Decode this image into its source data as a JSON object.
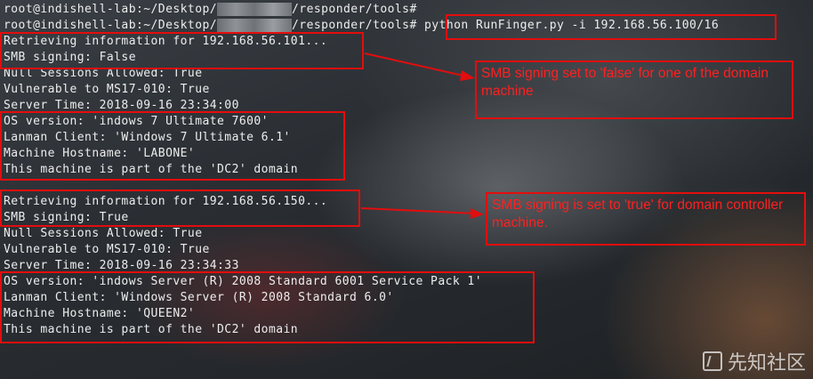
{
  "terminal": {
    "prompt_line_1": {
      "prefix": "root@indishell-lab:~/Desktop/",
      "suffix": "/responder/tools#"
    },
    "prompt_line_2": {
      "prefix": "root@indishell-lab:~/Desktop/",
      "suffix": "/responder/tools#",
      "command": " python RunFinger.py -i 192.168.56.100/16"
    },
    "host1": {
      "retrieving": "Retrieving information for 192.168.56.101...",
      "smb_signing": "SMB signing: False",
      "null_sessions": "Null Sessions Allowed: True",
      "vulnerable": "Vulnerable to MS17-010: True",
      "server_time": "Server Time: 2018-09-16 23:34:00",
      "os_version": "OS version: 'indows 7 Ultimate 7600'",
      "lanman": "Lanman Client: 'Windows 7 Ultimate 6.1'",
      "hostname": "Machine Hostname: 'LABONE'",
      "domain": "This machine is part of the 'DC2' domain"
    },
    "host2": {
      "retrieving": "Retrieving information for 192.168.56.150...",
      "smb_signing": "SMB signing: True",
      "null_sessions": "Null Sessions Allowed: True",
      "vulnerable": "Vulnerable to MS17-010: True",
      "server_time": "Server Time: 2018-09-16 23:34:33",
      "os_version": "OS version: 'indows Server (R) 2008 Standard 6001 Service Pack 1'",
      "lanman": "Lanman Client: 'Windows Server (R) 2008 Standard 6.0'",
      "hostname": "Machine Hostname: 'QUEEN2'",
      "domain": "This machine is part of the 'DC2' domain"
    }
  },
  "annotations": {
    "note1": "SMB signing set to 'false' for one of the domain machine",
    "note2": "SMB signing is set to 'true' for domain controller machine."
  },
  "watermark": {
    "text": "先知社区",
    "icon": "xianzhi-logo-icon"
  },
  "colors": {
    "annotation_red": "#e30d0d",
    "terminal_text": "#ededed"
  }
}
